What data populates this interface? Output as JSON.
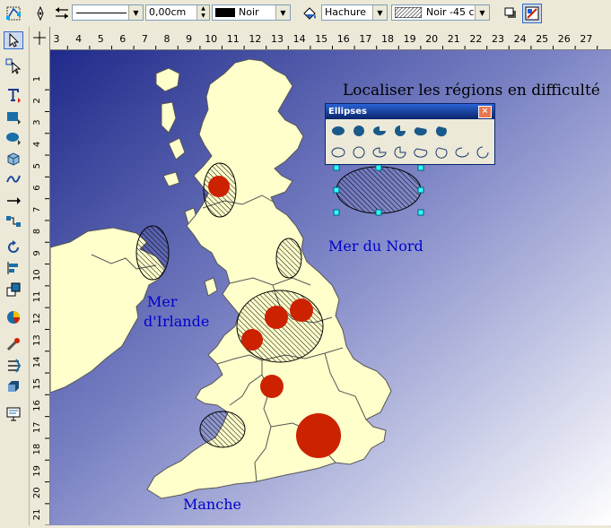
{
  "toolbar": {
    "line_width": "0,00cm",
    "line_color": "Noir",
    "area_style": "Hachure",
    "hatch_pattern": "Noir -45 c",
    "line_style_placeholder": ""
  },
  "ruler": {
    "h_ticks": [
      "3",
      "4",
      "5",
      "6",
      "7",
      "8",
      "9",
      "10",
      "11",
      "12",
      "13",
      "14",
      "15",
      "16",
      "17",
      "18",
      "19",
      "20",
      "21",
      "22",
      "23",
      "24",
      "25",
      "26",
      "27"
    ],
    "v_ticks": [
      "1",
      "2",
      "3",
      "4",
      "5",
      "6",
      "7",
      "8",
      "9",
      "10",
      "11",
      "12",
      "13",
      "14",
      "15",
      "16",
      "17",
      "18",
      "19",
      "20",
      "21"
    ]
  },
  "slide": {
    "title": "Localiser les régions en difficulté",
    "label_north_sea": "Mer du Nord",
    "label_irish_sea_1": "Mer",
    "label_irish_sea_2": "d'Irlande",
    "label_channel": "Manche",
    "map_fill": "#ffffcc",
    "problem_color": "#cc2200",
    "text_color": "#0000cc"
  },
  "palette": {
    "title": "Ellipses",
    "close": "×"
  }
}
